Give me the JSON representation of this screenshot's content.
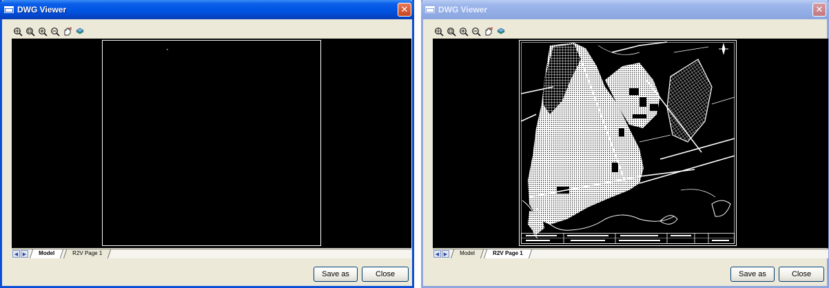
{
  "windows": [
    {
      "title": "DWG Viewer",
      "toolbar": {
        "icons": [
          "zoom-extents-icon",
          "zoom-window-icon",
          "zoom-in-icon",
          "zoom-out-icon",
          "pan-icon",
          "layers-icon"
        ]
      },
      "tabs": [
        {
          "label": "Model",
          "active": true
        },
        {
          "label": "R2V Page 1",
          "active": false
        }
      ],
      "buttons": {
        "save_as": "Save as",
        "close": "Close"
      },
      "state": "active"
    },
    {
      "title": "DWG Viewer",
      "toolbar": {
        "icons": [
          "zoom-extents-icon",
          "zoom-window-icon",
          "zoom-in-icon",
          "zoom-out-icon",
          "pan-icon",
          "layers-icon"
        ]
      },
      "tabs": [
        {
          "label": "Model",
          "active": false
        },
        {
          "label": "R2V Page 1",
          "active": true
        }
      ],
      "buttons": {
        "save_as": "Save as",
        "close": "Close"
      },
      "state": "inactive"
    }
  ],
  "colors": {
    "active_title": "#0054e3",
    "inactive_title": "#94aee6",
    "window_bg": "#ece9d8",
    "canvas": "#000000",
    "drawing": "#ffffff"
  }
}
